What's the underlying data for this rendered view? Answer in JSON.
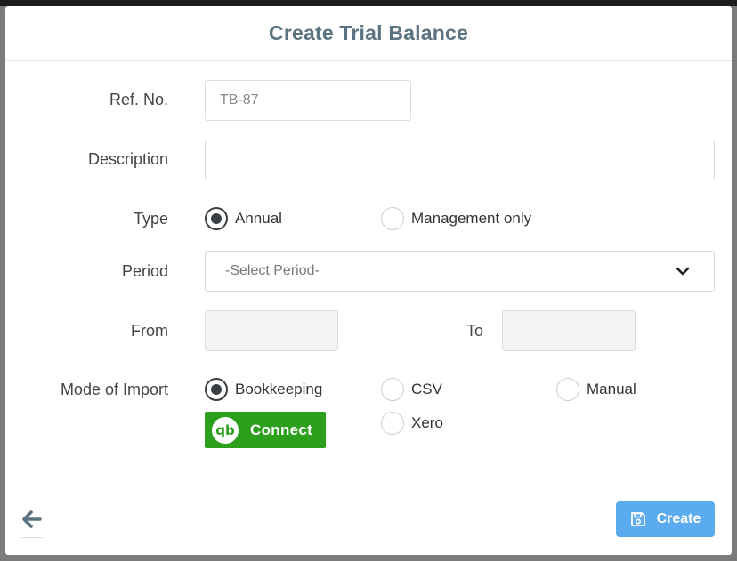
{
  "modal": {
    "title": "Create Trial Balance"
  },
  "form": {
    "ref_no": {
      "label": "Ref. No.",
      "placeholder": "TB-87",
      "value": ""
    },
    "description": {
      "label": "Description",
      "value": ""
    },
    "type": {
      "label": "Type",
      "options": [
        {
          "label": "Annual",
          "checked": true
        },
        {
          "label": "Management only",
          "checked": false
        }
      ]
    },
    "period": {
      "label": "Period",
      "selected": "-Select Period-"
    },
    "from": {
      "label": "From",
      "value": ""
    },
    "to": {
      "label": "To",
      "value": ""
    },
    "mode_of_import": {
      "label": "Mode of Import",
      "options": [
        {
          "label": "Bookkeeping",
          "checked": true
        },
        {
          "label": "CSV",
          "checked": false
        },
        {
          "label": "Manual",
          "checked": false
        },
        {
          "label": "Xero",
          "checked": false
        }
      ],
      "connect_button": {
        "logo": "qb",
        "label": "Connect"
      }
    }
  },
  "footer": {
    "back_icon": "arrow-left-icon",
    "create_label": "Create",
    "create_icon": "save-icon"
  },
  "colors": {
    "title": "#5b7381",
    "primary_button": "#5aabf0",
    "quickbooks_green": "#2ca01c"
  }
}
